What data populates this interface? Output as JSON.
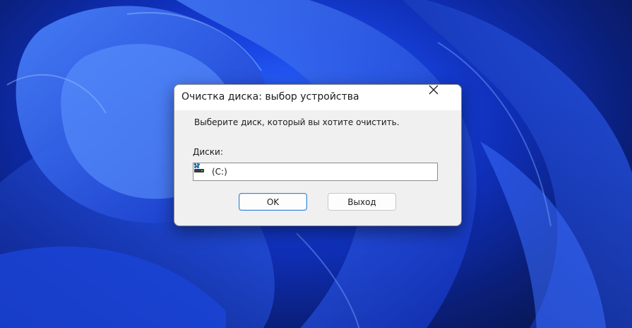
{
  "dialog": {
    "title": "Очистка диска: выбор устройства",
    "prompt": "Выберите диск, который вы хотите очистить.",
    "drives_label": "Диски:",
    "selected_drive": "(C:)",
    "ok_label": "OK",
    "exit_label": "Выход",
    "close_icon": "close-icon",
    "drive_icon": "windows-drive-icon",
    "dropdown_icon": "chevron-down-icon"
  },
  "colors": {
    "accent_border": "#3a86d6",
    "dialog_bg": "#f0f0f0",
    "titlebar_bg": "#ffffff"
  }
}
